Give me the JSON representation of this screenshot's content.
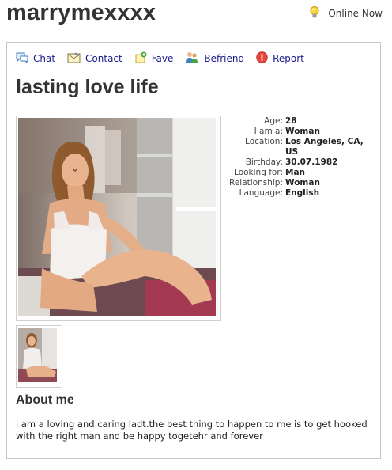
{
  "header": {
    "username": "marrymexxxx",
    "status_label": "Online Now"
  },
  "actions": [
    {
      "label": "Chat",
      "icon": "chat-icon"
    },
    {
      "label": "Contact",
      "icon": "envelope-icon"
    },
    {
      "label": "Fave",
      "icon": "favorite-icon"
    },
    {
      "label": "Befriend",
      "icon": "friends-icon"
    },
    {
      "label": "Report",
      "icon": "report-icon"
    }
  ],
  "profile": {
    "title": "lasting love life",
    "details": [
      {
        "key": "Age:",
        "value": "28"
      },
      {
        "key": "I am a:",
        "value": "Woman"
      },
      {
        "key": "Location:",
        "value": "Los Angeles, CA, US"
      },
      {
        "key": "Birthday:",
        "value": "30.07.1982"
      },
      {
        "key": "Looking for:",
        "value": "Man"
      },
      {
        "key": "Relationship:",
        "value": "Woman"
      },
      {
        "key": "Language:",
        "value": "English"
      }
    ],
    "about_heading": "About me",
    "about_text": "i am a loving and caring ladt.the best thing to happen to me is to get hooked with the right man and be happy togetehr and forever"
  },
  "colors": {
    "link": "#1a1a8a",
    "heading": "#333333",
    "border": "#c7c7c7"
  }
}
